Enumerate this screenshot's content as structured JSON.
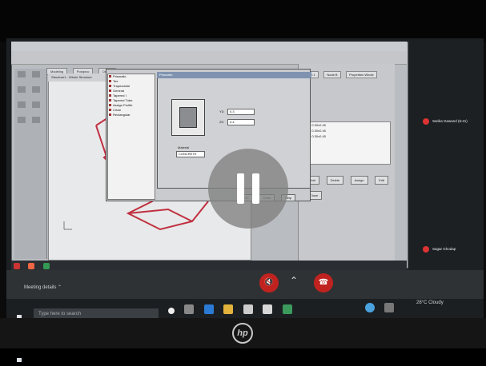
{
  "app": {
    "window_tabs": [
      "Modeling",
      "Postproc",
      "Design"
    ],
    "drawing_title": "Structure1 - Whole Structure",
    "right_panel_tabs": [
      "Beam 1",
      "Node B",
      "Properties Whole"
    ],
    "right_panel_list": [
      "Rect 0.30x0.45",
      "Rect 0.30x0.45",
      "Rect 0.30x0.45"
    ],
    "right_panel_buttons": [
      "Add",
      "Delete",
      "Assign",
      "Edit",
      "Close"
    ]
  },
  "dialog": {
    "tree_items": [
      "Prismatic",
      "Tee",
      "Trapezoidal",
      "General",
      "Tapered I",
      "Tapered Tube",
      "Assign Profile",
      "Circle",
      "Rectangular"
    ],
    "title": "Prismatic",
    "fields": [
      {
        "label": "YD",
        "value": "0.3"
      },
      {
        "label": "ZD",
        "value": "0.4"
      }
    ],
    "material_label": "Material",
    "material_value": "CONCRETE",
    "buttons": [
      "OK",
      "Close",
      "Help"
    ]
  },
  "meeting": {
    "participants": [
      {
        "name": "Sarika Gawand (6:41)"
      },
      {
        "name": "Sagar Ghodap"
      }
    ],
    "details_label": "Meeting details",
    "pause_icon": "pause-icon",
    "mute_icon": "mic-off-icon",
    "end_icon": "end-call-icon"
  },
  "taskbar": {
    "search_placeholder": "Type here to search",
    "weather": "28°C Cloudy"
  },
  "device": {
    "logo_text": "hp"
  },
  "colors": {
    "call_red": "#c0231f",
    "structure_red": "#c03040",
    "pause_overlay": "#808080"
  }
}
